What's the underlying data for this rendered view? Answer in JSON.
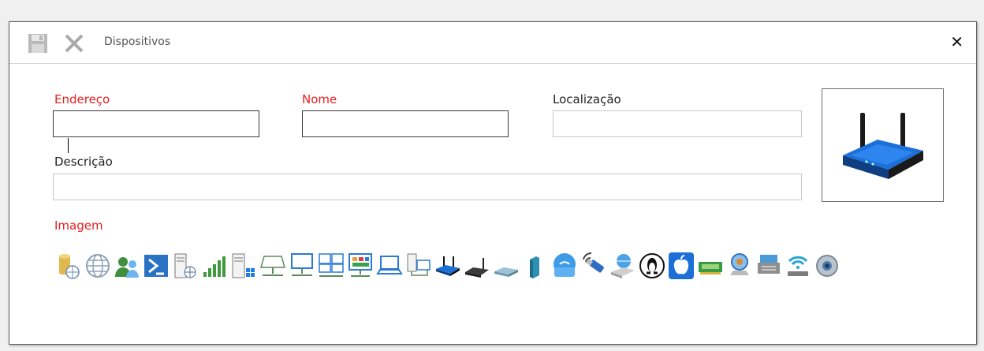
{
  "window": {
    "title": "Dispositivos",
    "toolbar": {
      "save_icon": "save-icon",
      "cancel_icon": "cancel-icon"
    },
    "close_label": "✕"
  },
  "form": {
    "endereco": {
      "label": "Endereço",
      "value": "",
      "required": true
    },
    "nome": {
      "label": "Nome",
      "value": "",
      "required": true
    },
    "localizacao": {
      "label": "Localização",
      "value": "",
      "required": false
    },
    "descricao": {
      "label": "Descrição",
      "value": "",
      "required": false
    },
    "imagem": {
      "label": "Imagem",
      "required": true
    }
  },
  "colors": {
    "required_label": "#e81e1e",
    "router_blue": "#1a6fd6",
    "window_border": "#5f5f5f"
  },
  "preview": {
    "icon": "wireless-router-icon"
  },
  "gallery_icons": [
    "database-globe-icon",
    "globe-icon",
    "users-group-icon",
    "powershell-icon",
    "server-globe-icon",
    "signal-bars-icon",
    "server-windows-icon",
    "network-drive-icon",
    "monitor-network-icon",
    "multi-monitor-network-icon",
    "dashboard-monitor-icon",
    "laptop-icon",
    "computers-network-icon",
    "wireless-router-icon",
    "router-icon",
    "switch-icon",
    "tower-device-icon",
    "wifi-access-point-icon",
    "usb-wireless-icon",
    "disk-globe-icon",
    "linux-icon",
    "apple-icon",
    "network-card-icon",
    "webcam-icon",
    "printer-server-icon",
    "wifi-device-icon",
    "webcam-eye-icon"
  ]
}
